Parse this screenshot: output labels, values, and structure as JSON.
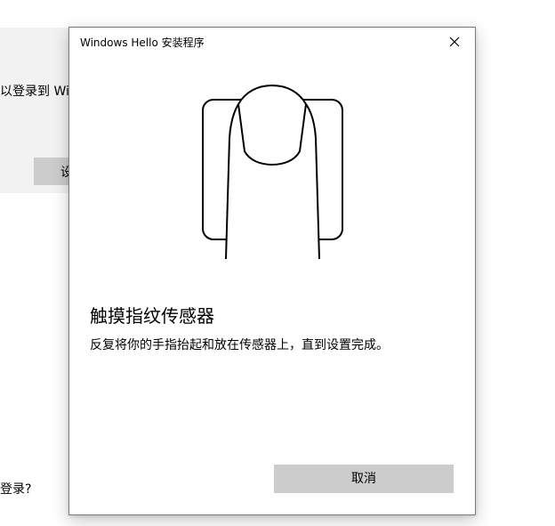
{
  "background_window": {
    "line_1": "以登录到 Win",
    "button_label": "设",
    "line_2": "登录?"
  },
  "dialog": {
    "title": "Windows Hello 安装程序",
    "close_icon": "close-icon",
    "illustration": "fingerprint-touch-icon",
    "heading": "触摸指纹传感器",
    "description": "反复将你的手指抬起和放在传感器上，直到设置完成。",
    "cancel_label": "取消"
  },
  "colors": {
    "button_bg": "#cccccc",
    "background_panel": "#f2f2f2",
    "dialog_border": "#7a7a7a"
  }
}
